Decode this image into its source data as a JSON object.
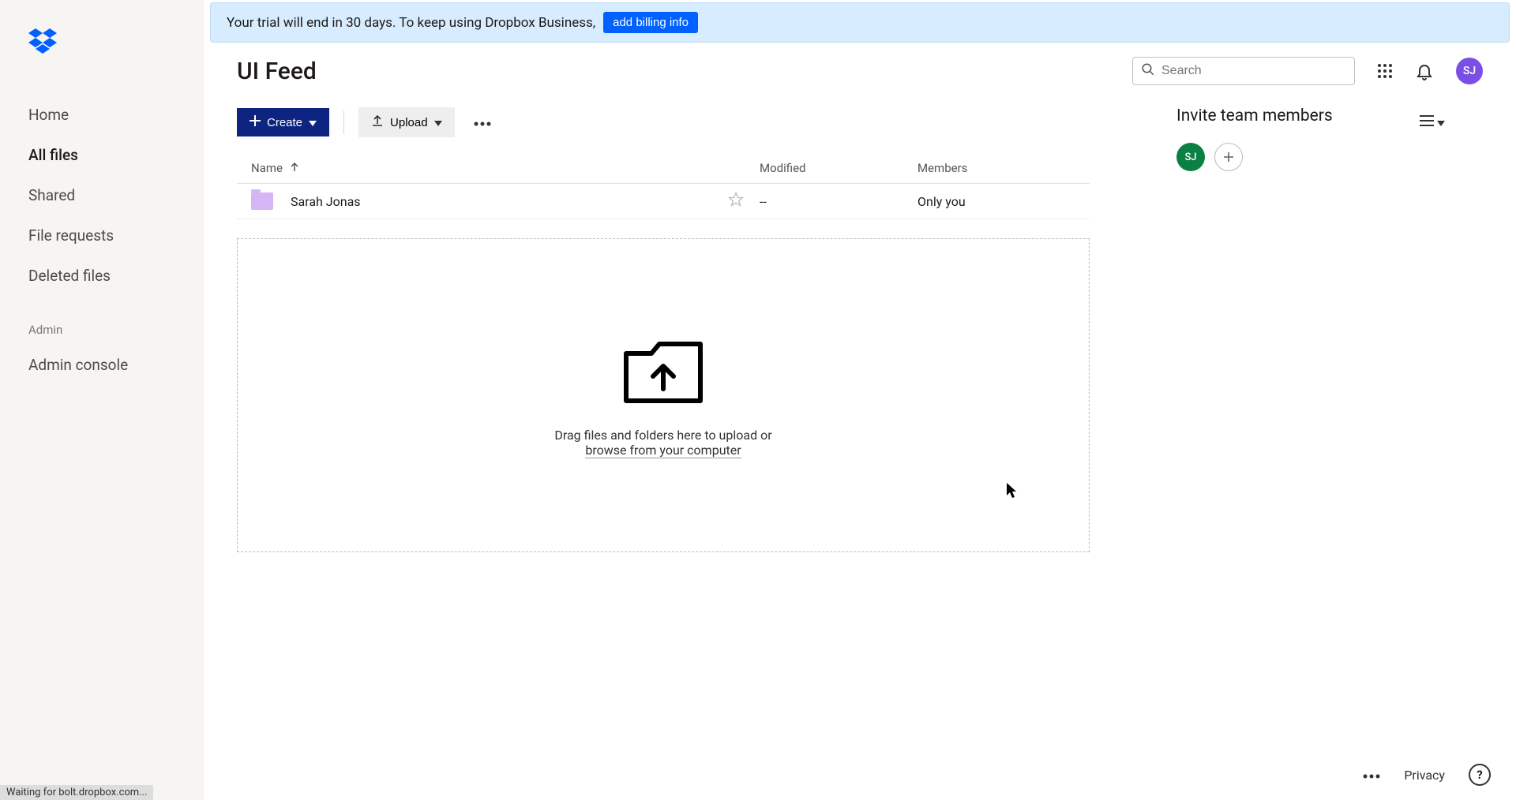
{
  "banner": {
    "text": "Your trial will end in 30 days. To keep using Dropbox Business,",
    "button": "add billing info"
  },
  "sidebar": {
    "items": [
      "Home",
      "All files",
      "Shared",
      "File requests",
      "Deleted files"
    ],
    "active_index": 1,
    "admin_header": "Admin",
    "admin_items": [
      "Admin console"
    ]
  },
  "page": {
    "title": "UI Feed"
  },
  "search": {
    "placeholder": "Search"
  },
  "header": {
    "avatar_initials": "SJ"
  },
  "toolbar": {
    "create": "Create",
    "upload": "Upload"
  },
  "table": {
    "columns": {
      "name": "Name",
      "modified": "Modified",
      "members": "Members"
    },
    "rows": [
      {
        "name": "Sarah Jonas",
        "modified": "--",
        "members": "Only you"
      }
    ]
  },
  "dropzone": {
    "line1": "Drag files and folders here to upload or",
    "link": "browse from your computer"
  },
  "right": {
    "title": "Invite team members",
    "avatar_initials": "SJ"
  },
  "footer": {
    "privacy": "Privacy"
  },
  "status": {
    "text": "Waiting for bolt.dropbox.com..."
  }
}
